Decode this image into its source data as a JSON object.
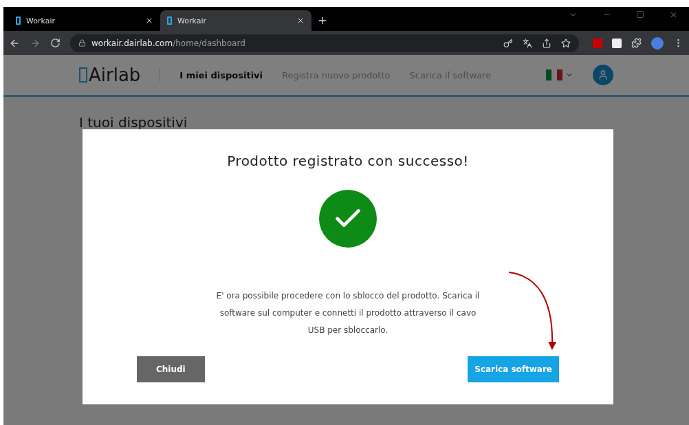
{
  "browser": {
    "tabs": [
      {
        "title": "Workair",
        "selected": false
      },
      {
        "title": "Workair",
        "selected": true
      }
    ],
    "url_host": "workair.dairlab.com",
    "url_path": "/home/dashboard"
  },
  "site": {
    "logo": "Airlab",
    "nav": [
      {
        "label": "I miei dispositivi",
        "selected": true
      },
      {
        "label": "Registra nuovo prodotto",
        "selected": false
      },
      {
        "label": "Scarica il software",
        "selected": false
      }
    ],
    "page_title": "I tuoi dispositivi"
  },
  "modal": {
    "title": "Prodotto registrato con successo!",
    "message": "E' ora possibile procedere con lo sblocco del prodotto. Scarica il software sul computer e connetti il prodotto attraverso il cavo USB per sbloccarlo.",
    "close_button": "Chiudi",
    "primary_button": "Scarica software"
  }
}
